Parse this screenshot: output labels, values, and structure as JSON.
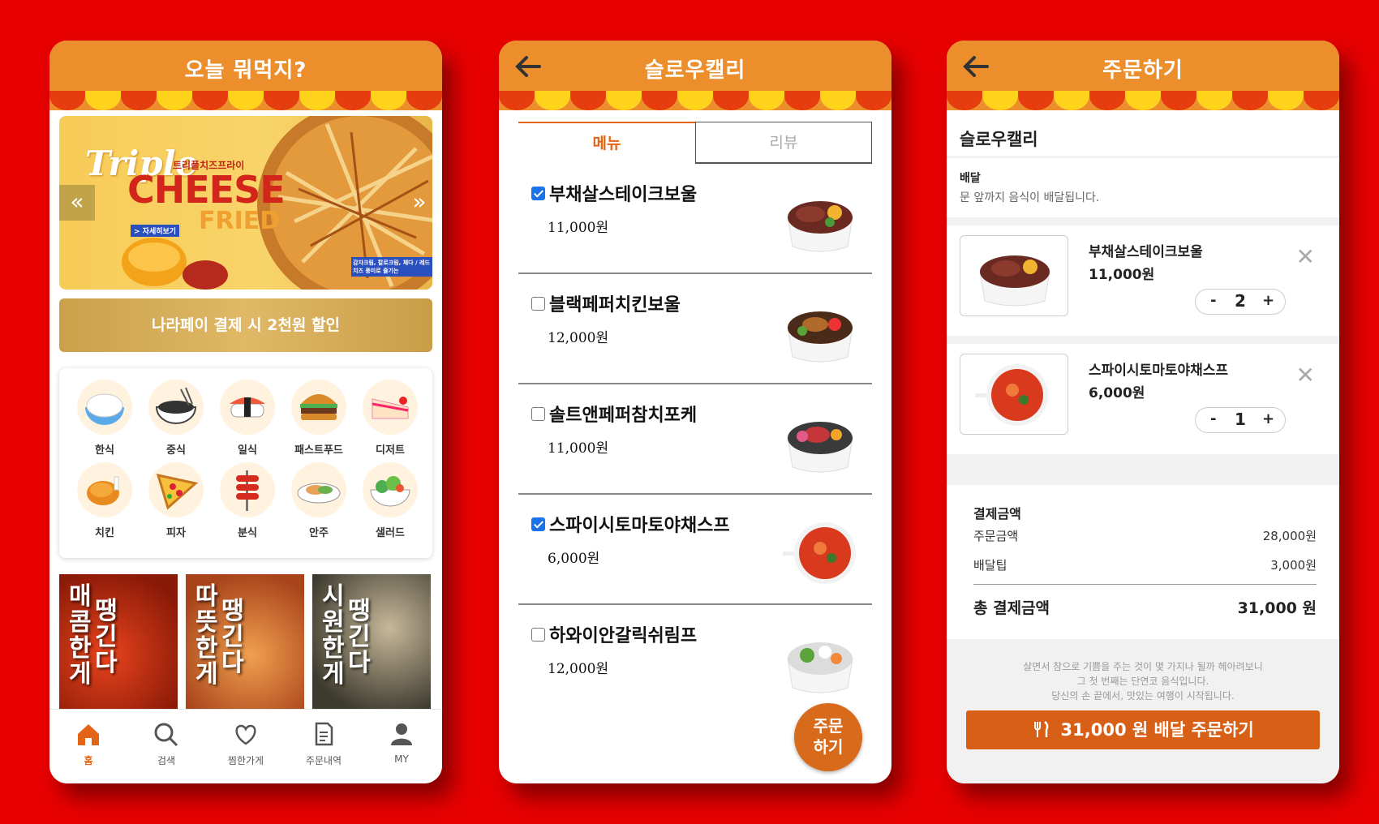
{
  "home": {
    "title": "오늘 뭐먹지?",
    "banner": {
      "script_text": "Triple",
      "headline": "CHEESE",
      "subline": "FRIED",
      "korean_tag": "트리플치즈프라이",
      "detail_chip": "> 자세히보기",
      "fine_print": "감자크림, 칼로크림, 체다 / 레드치즈 풍미로 즐기는",
      "prev": "«",
      "next": "»"
    },
    "pay_banner": "나라페이 결제 시 2천원 할인",
    "categories": [
      {
        "label": "한식",
        "icon": "rice-bowl-icon"
      },
      {
        "label": "중식",
        "icon": "noodle-bowl-icon"
      },
      {
        "label": "일식",
        "icon": "sushi-icon"
      },
      {
        "label": "패스트푸드",
        "icon": "burger-icon"
      },
      {
        "label": "디저트",
        "icon": "cake-icon"
      },
      {
        "label": "치킨",
        "icon": "chicken-icon"
      },
      {
        "label": "피자",
        "icon": "pizza-icon"
      },
      {
        "label": "분식",
        "icon": "tteokbokki-icon"
      },
      {
        "label": "안주",
        "icon": "side-dish-icon"
      },
      {
        "label": "샐러드",
        "icon": "salad-icon"
      }
    ],
    "tiles": [
      {
        "col1": "매콤한게",
        "col2": "땡긴다"
      },
      {
        "col1": "따뜻한게",
        "col2": "땡긴다"
      },
      {
        "col1": "시원한게",
        "col2": "땡긴다"
      }
    ],
    "nav": [
      {
        "label": "홈",
        "icon": "home-icon",
        "active": true
      },
      {
        "label": "검색",
        "icon": "search-icon",
        "active": false
      },
      {
        "label": "찜한가게",
        "icon": "heart-icon",
        "active": false
      },
      {
        "label": "주문내역",
        "icon": "receipt-icon",
        "active": false
      },
      {
        "label": "MY",
        "icon": "user-icon",
        "active": false
      }
    ]
  },
  "store": {
    "title": "슬로우캘리",
    "tabs": {
      "menu": "메뉴",
      "review": "리뷰"
    },
    "items": [
      {
        "name": "부채살스테이크보울",
        "price": "11,000원",
        "checked": true
      },
      {
        "name": "블랙페퍼치킨보울",
        "price": "12,000원",
        "checked": false
      },
      {
        "name": "솔트앤페퍼참치포케",
        "price": "11,000원",
        "checked": false
      },
      {
        "name": "스파이시토마토야채스프",
        "price": "6,000원",
        "checked": true
      },
      {
        "name": "하와이안갈릭쉬림프",
        "price": "12,000원",
        "checked": false
      }
    ],
    "order_fab": {
      "line1": "주문",
      "line2": "하기"
    }
  },
  "checkout": {
    "title": "주문하기",
    "store_name": "슬로우캘리",
    "delivery": {
      "heading": "배달",
      "text": "문 앞까지 음식이 배달됩니다."
    },
    "items": [
      {
        "name": "부채살스테이크보울",
        "price": "11,000원",
        "qty": "2"
      },
      {
        "name": "스파이시토마토야채스프",
        "price": "6,000원",
        "qty": "1"
      }
    ],
    "stepper": {
      "minus": "-",
      "plus": "+"
    },
    "remove": "✕",
    "summary": {
      "heading": "결제금액",
      "order_label": "주문금액",
      "order_value": "28,000원",
      "tip_label": "배달팁",
      "tip_value": "3,000원",
      "total_label": "총 결제금액",
      "total_value": "31,000 원"
    },
    "quote": [
      "살면서 참으로 기쁨을 주는 것이 몇 가지나 될까 헤아려보니",
      "그 첫 번째는 단연코 음식입니다.",
      "당신의 손 끝에서, 맛있는 여행이 시작됩니다."
    ],
    "order_button": "31,000 원 배달 주문하기"
  },
  "colors": {
    "background": "#e80000",
    "header": "#ec8e2c",
    "scallop_red": "#e63d0e",
    "scallop_yellow": "#ffd21c",
    "accent": "#d85f16",
    "checkbox": "#1a73e8"
  }
}
